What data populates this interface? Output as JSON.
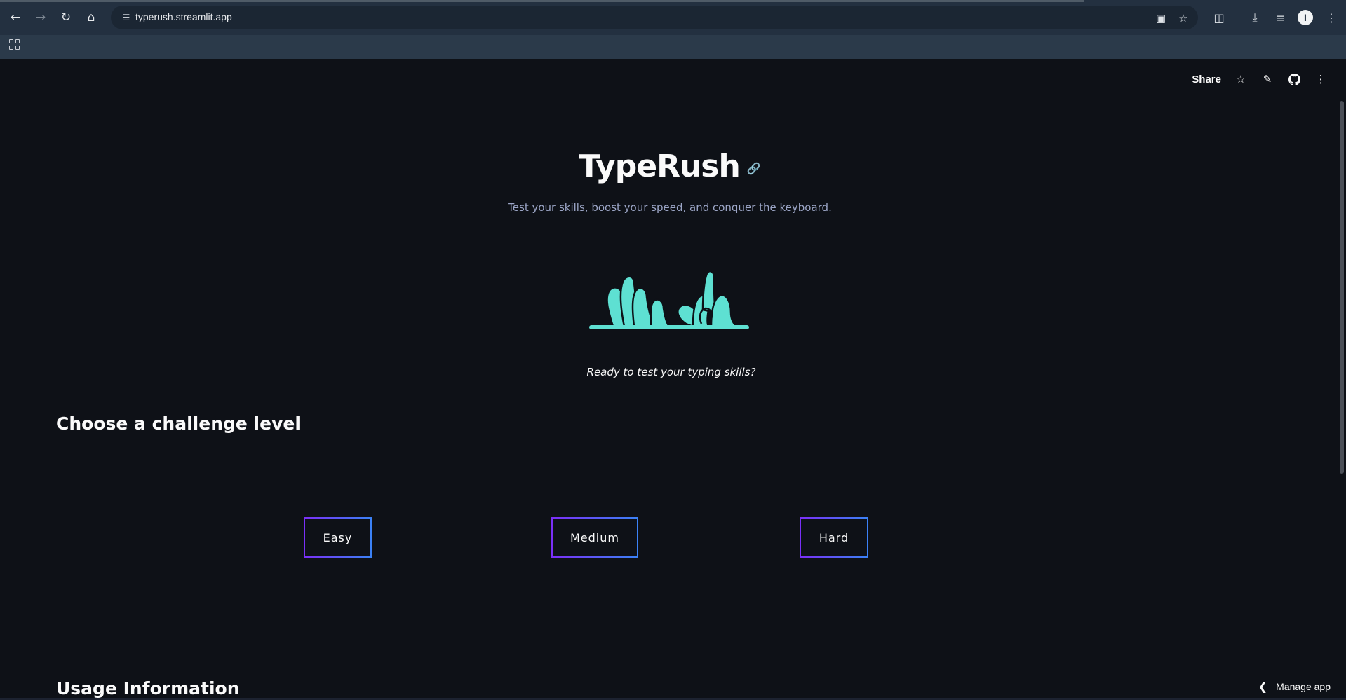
{
  "browser": {
    "url": "typerush.streamlit.app",
    "icons": {
      "back": "arrow-left-icon",
      "forward": "arrow-right-icon",
      "reload": "reload-icon",
      "home": "home-icon",
      "site_info": "tune-icon",
      "install": "install-app-icon",
      "bookmark": "star-icon",
      "extensions": "puzzle-icon",
      "downloads": "download-icon",
      "reading_list": "reading-list-icon",
      "menu": "kebab-menu-icon",
      "apps": "apps-grid-icon"
    },
    "profile_initial": "I",
    "colors": {
      "toolbar": "#233040",
      "omnibox": "#1b2633",
      "bookmarks_bar": "#2b3a4a"
    }
  },
  "app": {
    "toolbar": {
      "share_label": "Share"
    },
    "title": "TypeRush",
    "subtitle": "Test your skills, boost your speed, and conquer the keyboard.",
    "tagline": "Ready to test your typing skills?",
    "challenge_heading": "Choose a challenge level",
    "levels": [
      {
        "label": "Easy"
      },
      {
        "label": "Medium"
      },
      {
        "label": "Hard"
      }
    ],
    "usage_heading": "Usage Information",
    "manage_app_label": "Manage app",
    "colors": {
      "background": "#0e1117",
      "text": "#fafafa",
      "subtitle": "#9ca6c7",
      "hands": "#5ee0d2",
      "button_border_start": "#7b2ff7",
      "button_border_end": "#3b82f6"
    }
  }
}
